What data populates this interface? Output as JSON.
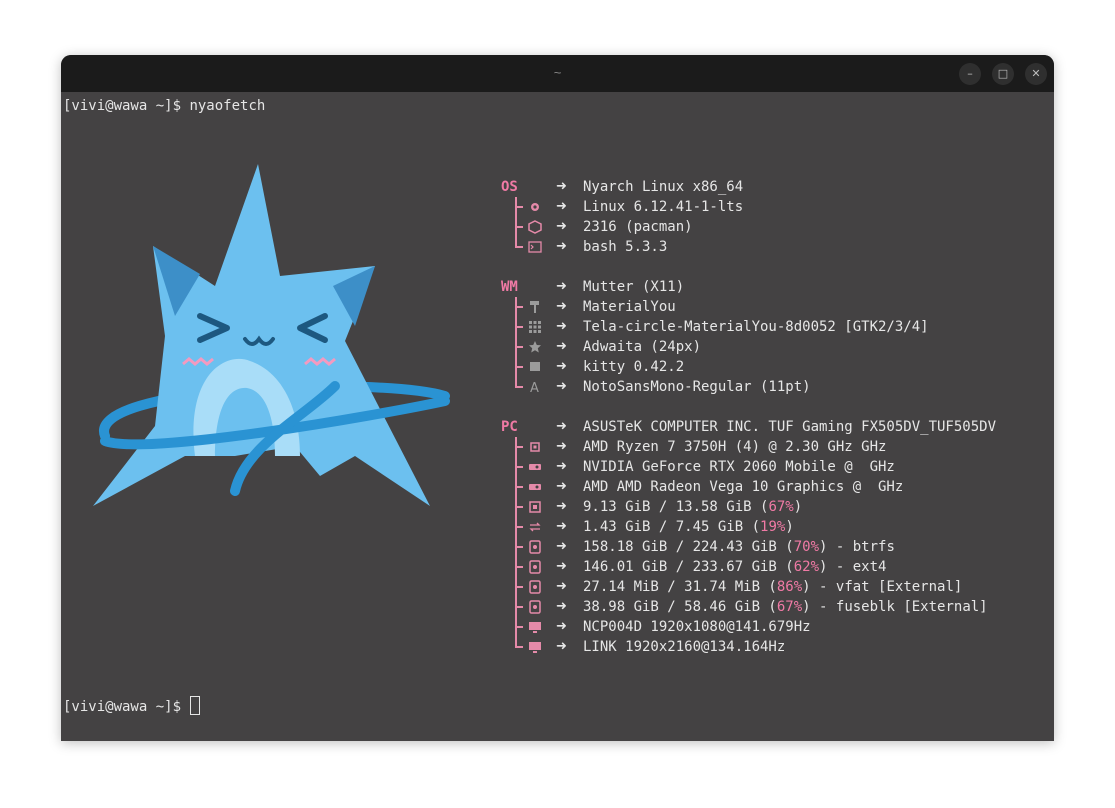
{
  "window": {
    "title": "~",
    "buttons": {
      "minimize": "–",
      "maximize": "□",
      "close": "✕"
    }
  },
  "terminal": {
    "prompt": "[vivi@wawa ~]$ ",
    "command": "nyaofetch"
  },
  "colors": {
    "accent": "#f07aa5",
    "logo_blue": "#6cc0ef",
    "background": "#444243"
  },
  "sections": [
    {
      "label": "OS",
      "rows": [
        {
          "icon": "arch-icon",
          "value": "Nyarch Linux x86_64"
        },
        {
          "icon": "gear-icon",
          "value": "Linux 6.12.41-1-lts"
        },
        {
          "icon": "package-icon",
          "value": "2316 (pacman)"
        },
        {
          "icon": "terminal-icon",
          "value": "bash 5.3.3"
        }
      ]
    },
    {
      "label": "WM",
      "rows": [
        {
          "icon": "window-icon",
          "value": "Mutter (X11)"
        },
        {
          "icon": "paint-roller-icon",
          "value": "MaterialYou"
        },
        {
          "icon": "grid-icon",
          "value": "Tela-circle-MaterialYou-8d0052 [GTK2/3/4]"
        },
        {
          "icon": "star-icon",
          "value": "Adwaita (24px)"
        },
        {
          "icon": "terminal-small-icon",
          "value": "kitty 0.42.2"
        },
        {
          "icon": "font-icon",
          "value": "NotoSansMono-Regular (11pt)"
        }
      ]
    },
    {
      "label": "PC",
      "rows": [
        {
          "icon": "computer-icon",
          "value": "ASUSTeK COMPUTER INC. TUF Gaming FX505DV_TUF505DV"
        },
        {
          "icon": "cpu-icon",
          "value": "AMD Ryzen 7 3750H (4) @ 2.30 GHz GHz"
        },
        {
          "icon": "gpu-icon",
          "value": "NVIDIA GeForce RTX 2060 Mobile @  GHz"
        },
        {
          "icon": "gpu-icon",
          "value": "AMD AMD Radeon Vega 10 Graphics @  GHz"
        },
        {
          "icon": "memory-icon",
          "pre": "9.13 GiB / 13.58 GiB (",
          "pct": "67%",
          "post": ")"
        },
        {
          "icon": "swap-icon",
          "pre": "1.43 GiB / 7.45 GiB (",
          "pct": "19%",
          "post": ")"
        },
        {
          "icon": "disk-icon",
          "pre": "158.18 GiB / 224.43 GiB (",
          "pct": "70%",
          "post": ") - btrfs"
        },
        {
          "icon": "disk-icon",
          "pre": "146.01 GiB / 233.67 GiB (",
          "pct": "62%",
          "post": ") - ext4"
        },
        {
          "icon": "disk-icon",
          "pre": "27.14 MiB / 31.74 MiB (",
          "pct": "86%",
          "post": ") - vfat [External]"
        },
        {
          "icon": "disk-icon",
          "pre": "38.98 GiB / 58.46 GiB (",
          "pct": "67%",
          "post": ") - fuseblk [External]"
        },
        {
          "icon": "monitor-icon",
          "value": "NCP004D 1920x1080@141.679Hz"
        },
        {
          "icon": "monitor-icon",
          "value": "LINK 1920x2160@134.164Hz"
        }
      ]
    }
  ],
  "arrow": "➜"
}
